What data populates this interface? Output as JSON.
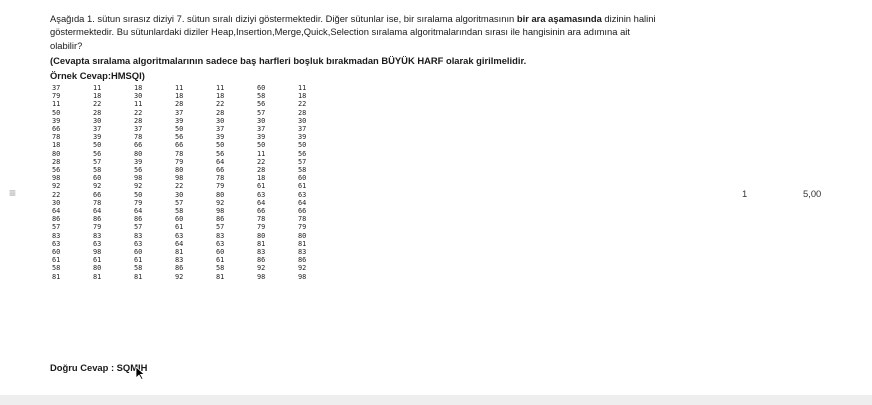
{
  "question": {
    "line1_pre": "Aşağıda 1. sütun sırasız diziyi 7. sütun sıralı diziyi göstermektedir. Diğer sütunlar ise, bir sıralama algoritmasının ",
    "line1_bold": "bir ara aşamasında",
    "line1_post": " dizinin halini",
    "line2": "göstermektedir. Bu sütunlardaki diziler Heap,Insertion,Merge,Quick,Selection sıralama algoritmalarından sırası ile hangisinin ara adımına ait",
    "line3": "olabilir?",
    "note": "(Cevapta sıralama algoritmalarının sadece baş harfleri boşluk bırakmadan BÜYÜK HARF olarak girilmelidir.",
    "example": "Örnek Cevap:HMSQI)"
  },
  "matrix_rows": [
    [
      "37",
      "11",
      "18",
      "11",
      "11",
      "60",
      "11"
    ],
    [
      "79",
      "18",
      "30",
      "18",
      "18",
      "58",
      "18"
    ],
    [
      "11",
      "22",
      "11",
      "28",
      "22",
      "56",
      "22"
    ],
    [
      "50",
      "28",
      "22",
      "37",
      "28",
      "57",
      "28"
    ],
    [
      "39",
      "30",
      "28",
      "39",
      "30",
      "30",
      "30"
    ],
    [
      "66",
      "37",
      "37",
      "50",
      "37",
      "37",
      "37"
    ],
    [
      "78",
      "39",
      "78",
      "56",
      "39",
      "39",
      "39"
    ],
    [
      "18",
      "50",
      "66",
      "66",
      "50",
      "50",
      "50"
    ],
    [
      "80",
      "56",
      "80",
      "78",
      "56",
      "11",
      "56"
    ],
    [
      "28",
      "57",
      "39",
      "79",
      "64",
      "22",
      "57"
    ],
    [
      "56",
      "58",
      "56",
      "80",
      "66",
      "28",
      "58"
    ],
    [
      "98",
      "60",
      "98",
      "98",
      "78",
      "18",
      "60"
    ],
    [
      "92",
      "92",
      "92",
      "22",
      "79",
      "61",
      "61"
    ],
    [
      "22",
      "66",
      "50",
      "30",
      "80",
      "63",
      "63"
    ],
    [
      "30",
      "78",
      "79",
      "57",
      "92",
      "64",
      "64"
    ],
    [
      "64",
      "64",
      "64",
      "58",
      "98",
      "66",
      "66"
    ],
    [
      "86",
      "86",
      "86",
      "60",
      "86",
      "78",
      "78"
    ],
    [
      "57",
      "79",
      "57",
      "61",
      "57",
      "79",
      "79"
    ],
    [
      "83",
      "83",
      "83",
      "63",
      "83",
      "80",
      "80"
    ],
    [
      "63",
      "63",
      "63",
      "64",
      "63",
      "81",
      "81"
    ],
    [
      "60",
      "98",
      "60",
      "81",
      "60",
      "83",
      "83"
    ],
    [
      "61",
      "61",
      "61",
      "83",
      "61",
      "86",
      "86"
    ],
    [
      "58",
      "80",
      "58",
      "86",
      "58",
      "92",
      "92"
    ],
    [
      "81",
      "81",
      "81",
      "92",
      "81",
      "98",
      "98"
    ]
  ],
  "answer": "Doğru Cevap : SQMIH",
  "side_values": {
    "count": "1",
    "score": "5,00"
  },
  "icons": {
    "drag_handle": "drag-handle-icon",
    "cursor": "mouse-pointer-icon"
  }
}
